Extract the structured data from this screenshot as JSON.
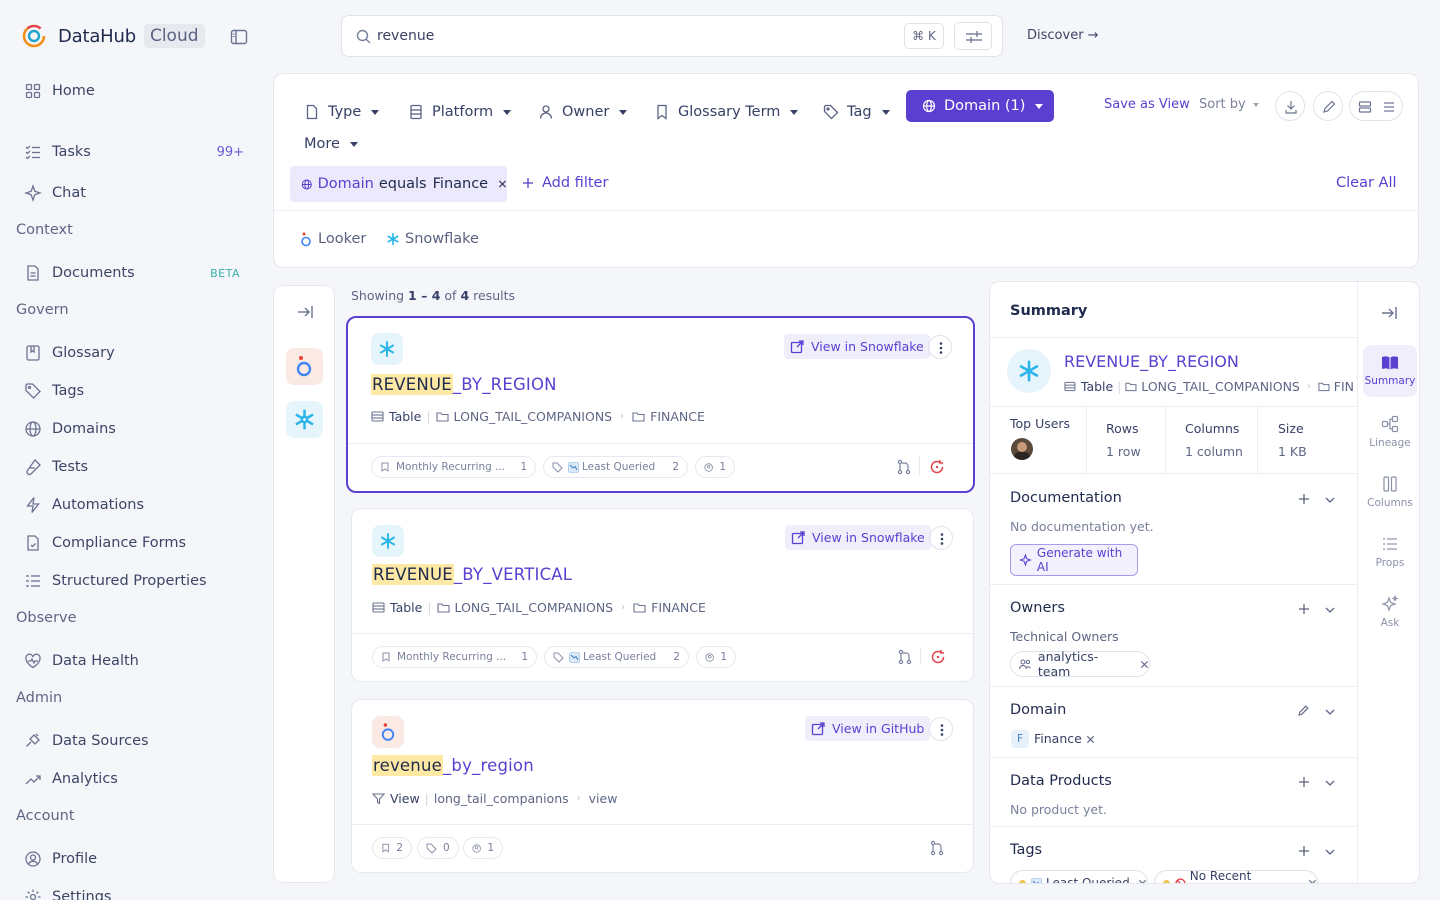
{
  "app": {
    "name": "DataHub",
    "edition": "Cloud"
  },
  "sidebar": {
    "home": "Home",
    "tasks": "Tasks",
    "tasks_badge": "99+",
    "chat": "Chat",
    "sections": {
      "context": "Context",
      "govern": "Govern",
      "observe": "Observe",
      "admin": "Admin",
      "account": "Account"
    },
    "documents": "Documents",
    "documents_badge": "BETA",
    "glossary": "Glossary",
    "tags": "Tags",
    "domains": "Domains",
    "tests": "Tests",
    "automations": "Automations",
    "compliance_forms": "Compliance Forms",
    "structured_properties": "Structured Properties",
    "data_health": "Data Health",
    "data_sources": "Data Sources",
    "analytics": "Analytics",
    "profile": "Profile",
    "settings": "Settings"
  },
  "search": {
    "query": "revenue",
    "shortcut": "⌘ K"
  },
  "discover": "Discover →",
  "filters": {
    "type": "Type",
    "platform": "Platform",
    "owner": "Owner",
    "glossary_term": "Glossary Term",
    "tag": "Tag",
    "domain": "Domain (1)",
    "more": "More",
    "save_as_view": "Save as View",
    "sort_by": "Sort by",
    "active_chip": {
      "field": "Domain",
      "op": "equals",
      "value": "Finance"
    },
    "add_filter": "Add filter",
    "clear_all": "Clear All",
    "platforms": [
      "Looker",
      "Snowflake"
    ]
  },
  "results": {
    "showing_prefix": "Showing",
    "range": "1 – 4",
    "of": "of",
    "total": "4",
    "suffix": "results",
    "cards": [
      {
        "title_hl": "REVENUE",
        "title_rest": "_BY_REGION",
        "view_in": "View in Snowflake",
        "type": "Table",
        "container": "LONG_TAIL_COMPANIONS",
        "schema": "FINANCE",
        "term": "Monthly Recurring ...",
        "term_count": "1",
        "tag": "Least Queried",
        "tag_count": "2",
        "owner_count": "1"
      },
      {
        "title_hl": "REVENUE",
        "title_rest": "_BY_VERTICAL",
        "view_in": "View in Snowflake",
        "type": "Table",
        "container": "LONG_TAIL_COMPANIONS",
        "schema": "FINANCE",
        "term": "Monthly Recurring ...",
        "term_count": "1",
        "tag": "Least Queried",
        "tag_count": "2",
        "owner_count": "1"
      },
      {
        "title_hl": "revenue",
        "title_rest": "_by_region",
        "view_in": "View in GitHub",
        "type": "View",
        "container": "long_tail_companions",
        "schema": "view",
        "term_count": "2",
        "tag_count": "0",
        "owner_count": "1"
      }
    ]
  },
  "summary": {
    "header": "Summary",
    "entity_name": "REVENUE_BY_REGION",
    "type": "Table",
    "container": "LONG_TAIL_COMPANIONS",
    "schema_trunc": "FIN",
    "stats": {
      "top_users_label": "Top Users",
      "rows_label": "Rows",
      "rows": "1 row",
      "columns_label": "Columns",
      "columns": "1 column",
      "size_label": "Size",
      "size": "1 KB"
    },
    "documentation": {
      "title": "Documentation",
      "empty": "No documentation yet.",
      "ai_button": "Generate with AI"
    },
    "owners": {
      "title": "Owners",
      "subtitle": "Technical Owners",
      "owner": "analytics-team"
    },
    "domain": {
      "title": "Domain",
      "initial": "F",
      "value": "Finance"
    },
    "data_products": {
      "title": "Data Products",
      "empty": "No product yet."
    },
    "tags": {
      "title": "Tags",
      "items": [
        "Least Queried",
        "No Recent Queries"
      ]
    },
    "tabs": [
      "Summary",
      "Lineage",
      "Columns",
      "Props",
      "Ask"
    ]
  },
  "colors": {
    "accent": "#5b3fd1",
    "highlight": "#fde9a3"
  }
}
